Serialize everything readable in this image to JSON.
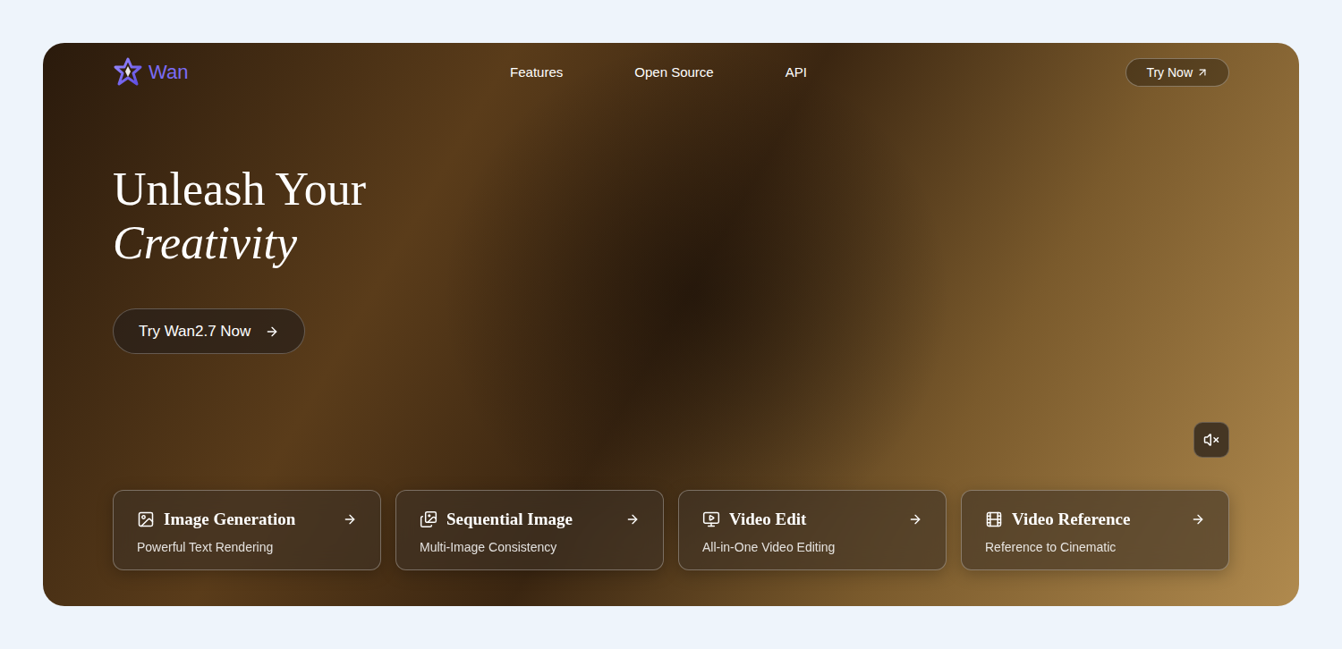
{
  "logo": {
    "text": "Wan"
  },
  "nav": {
    "links": [
      {
        "label": "Features"
      },
      {
        "label": "Open Source"
      },
      {
        "label": "API"
      }
    ],
    "cta": "Try Now"
  },
  "hero": {
    "title_line1": "Unleash Your",
    "title_line2": "Creativity",
    "button": "Try Wan2.7 Now"
  },
  "sound": {
    "muted": true
  },
  "features": [
    {
      "title": "Image Generation",
      "subtitle": "Powerful Text Rendering"
    },
    {
      "title": "Sequential Image",
      "subtitle": "Multi-Image Consistency"
    },
    {
      "title": "Video Edit",
      "subtitle": "All-in-One Video Editing"
    },
    {
      "title": "Video Reference",
      "subtitle": "Reference to Cinematic"
    }
  ]
}
